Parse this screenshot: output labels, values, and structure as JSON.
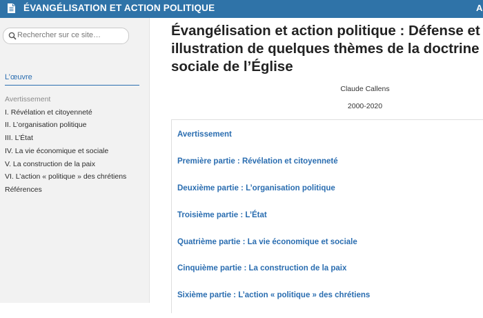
{
  "header": {
    "site_title": "ÉVANGÉLISATION ET ACTION POLITIQUE",
    "right_text": "A",
    "icon": "document-icon"
  },
  "sidebar": {
    "search_placeholder": "Rechercher sur ce site…",
    "section_label": "L’œuvre",
    "items": [
      {
        "label": "Avertissement"
      },
      {
        "label": "I. Révélation et citoyenneté"
      },
      {
        "label": "II. L’organisation politique"
      },
      {
        "label": "III. L’État"
      },
      {
        "label": "IV. La vie économique et sociale"
      },
      {
        "label": "V. La construction de la paix"
      },
      {
        "label": "VI. L’action « politique » des chrétiens"
      },
      {
        "label": "Références"
      }
    ]
  },
  "main": {
    "title": "Évangélisation et action politique : Défense et illustration de quelques thèmes de la doctrine sociale de l’Église",
    "author": "Claude Callens",
    "dates": "2000-2020",
    "parts": [
      {
        "label": "Avertissement"
      },
      {
        "label": "Première partie : Révélation et citoyenneté"
      },
      {
        "label": "Deuxième partie : L’organisation politique"
      },
      {
        "label": "Troisième partie : L’État"
      },
      {
        "label": "Quatrième partie : La vie économique et sociale"
      },
      {
        "label": "Cinquième partie : La construction de la paix"
      },
      {
        "label": "Sixième partie : L’action « politique » des chrétiens"
      }
    ]
  },
  "colors": {
    "header_bg": "#2f73a8",
    "link": "#2a6db0",
    "sidebar_bg": "#f2f2f2"
  }
}
